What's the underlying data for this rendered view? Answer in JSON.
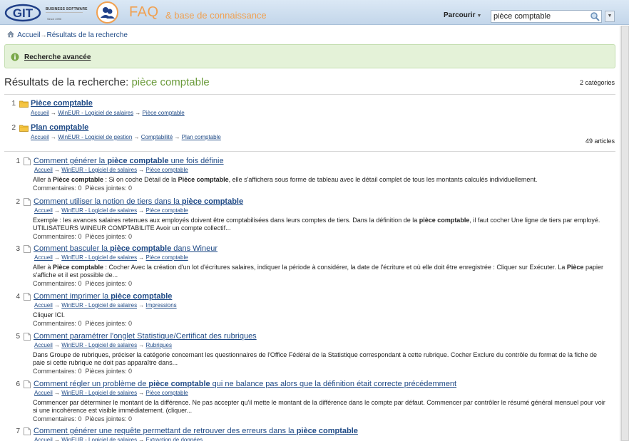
{
  "header": {
    "logo_text": "GIT",
    "logo_subtitle": "BUSINESS SOFTWARE",
    "logo_since": "Since 1990",
    "app_title": "FAQ",
    "app_subtitle": "& base de connaissance",
    "browse_label": "Parcourir",
    "search_value": "pièce comptable"
  },
  "breadcrumb": {
    "home": "Accueil",
    "current": "Résultats de la recherche"
  },
  "advanced_search_label": "Recherche avancée",
  "results": {
    "heading_prefix": "Résultats de la recherche:",
    "query": "pièce comptable",
    "category_count": "2 catégories",
    "article_count": "49 articles"
  },
  "categories": [
    {
      "num": "1",
      "title": "Pièce comptable",
      "path": [
        "Accueil",
        "WinEUR - Logiciel de salaires",
        "Pièce comptable"
      ]
    },
    {
      "num": "2",
      "title": "Plan comptable",
      "path": [
        "Accueil",
        "WinEUR - Logiciel de gestion",
        "Comptabilité",
        "Plan comptable"
      ]
    }
  ],
  "articles": [
    {
      "num": "1",
      "title": [
        [
          "Comment générer la ",
          false
        ],
        [
          "pièce comptable",
          true
        ],
        [
          " une fois définie",
          false
        ]
      ],
      "path": [
        "Accueil",
        "WinEUR - Logiciel de salaires",
        "Pièce comptable"
      ],
      "excerpt": [
        [
          "Aller à ",
          false
        ],
        [
          "Pièce comptable",
          true
        ],
        [
          " : Si on coche Détail de la ",
          false
        ],
        [
          "Pièce comptable",
          true
        ],
        [
          ", elle s'affichera sous forme de tableau avec le détail complet de tous les montants calculés individuellement.",
          false
        ]
      ],
      "comments": "Commentaires: 0",
      "attachments": "Pièces jointes: 0"
    },
    {
      "num": "2",
      "title": [
        [
          "Comment utiliser la notion de tiers dans la ",
          false
        ],
        [
          "pièce comptable",
          true
        ]
      ],
      "path": [
        "Accueil",
        "WinEUR - Logiciel de salaires",
        "Pièce comptable"
      ],
      "excerpt": [
        [
          "Exemple : les avances salaires retenues aux employés doivent être comptabilisées dans leurs comptes de tiers. Dans la définition de la ",
          false
        ],
        [
          "pièce comptable",
          true
        ],
        [
          ", il faut cocher Une ligne de tiers par employé. UTILISATEURS WINEUR COMPTABILITE Avoir un compte collectif...",
          false
        ]
      ],
      "comments": "Commentaires: 0",
      "attachments": "Pièces jointes: 0"
    },
    {
      "num": "3",
      "title": [
        [
          "Comment basculer la ",
          false
        ],
        [
          "pièce comptable",
          true
        ],
        [
          " dans Wineur",
          false
        ]
      ],
      "path": [
        "Accueil",
        "WinEUR - Logiciel de salaires",
        "Pièce comptable"
      ],
      "excerpt": [
        [
          "Aller à ",
          false
        ],
        [
          "Pièce comptable",
          true
        ],
        [
          " : Cocher Avec la création d'un lot d'écritures salaires, indiquer la période à considérer, la date de l'écriture et où elle doit être enregistrée : Cliquer sur Exécuter. La ",
          false
        ],
        [
          "Pièce",
          true
        ],
        [
          " papier s'affiche et il est possible de...",
          false
        ]
      ],
      "comments": "Commentaires: 0",
      "attachments": "Pièces jointes: 0"
    },
    {
      "num": "4",
      "title": [
        [
          "Comment imprimer la ",
          false
        ],
        [
          "pièce comptable",
          true
        ]
      ],
      "path": [
        "Accueil",
        "WinEUR - Logiciel de salaires",
        "Impressions"
      ],
      "excerpt": [
        [
          "Cliquer ICI.",
          false
        ]
      ],
      "comments": "Commentaires: 0",
      "attachments": "Pièces jointes: 0"
    },
    {
      "num": "5",
      "title": [
        [
          "Comment paramétrer l'onglet Statistique/Certificat des rubriques",
          false
        ]
      ],
      "path": [
        "Accueil",
        "WinEUR - Logiciel de salaires",
        "Rubriques"
      ],
      "excerpt": [
        [
          "Dans Groupe de rubriques, préciser la catégorie concernant les questionnaires de l'Office Fédéral de la Statistique correspondant à cette rubrique. Cocher Exclure du contrôle du format de la fiche de paie si cette rubrique ne doit pas apparaître dans...",
          false
        ]
      ],
      "comments": "Commentaires: 0",
      "attachments": "Pièces jointes: 0"
    },
    {
      "num": "6",
      "title": [
        [
          "Comment régler un problème de ",
          false
        ],
        [
          "pièce comptable",
          true
        ],
        [
          " qui ne balance pas alors que la définition était correcte précédemment",
          false
        ]
      ],
      "path": [
        "Accueil",
        "WinEUR - Logiciel de salaires",
        "Pièce comptable"
      ],
      "excerpt": [
        [
          "Commencer par déterminer le montant de la différence. Ne pas accepter qu'il mette le montant de la différence dans le compte par défaut. Commencer par contrôler le résumé général mensuel pour voir si une incohérence est visible immédiatement. (cliquer...",
          false
        ]
      ],
      "comments": "Commentaires: 0",
      "attachments": "Pièces jointes: 0"
    },
    {
      "num": "7",
      "title": [
        [
          "Comment générer une requête permettant de retrouver des erreurs dans la ",
          false
        ],
        [
          "pièce comptable",
          true
        ]
      ],
      "path": [
        "Accueil",
        "WinEUR - Logiciel de salaires",
        "Extraction de données"
      ],
      "excerpt": [],
      "comments": "",
      "attachments": ""
    }
  ],
  "colors": {
    "header_bg": "#c3d6ea",
    "accent_orange": "#f0a050",
    "link": "#1f4a86",
    "query_green": "#6a9a3a",
    "adv_bg": "#e4f2d8"
  }
}
